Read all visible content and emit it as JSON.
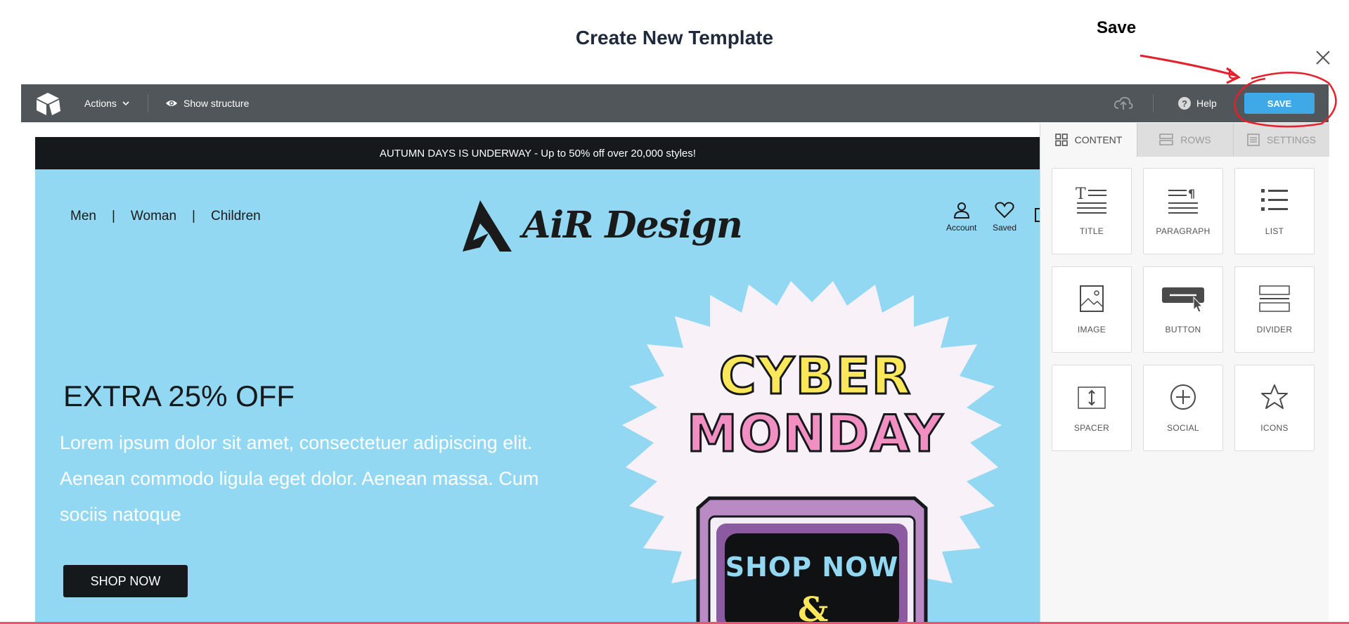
{
  "modal": {
    "title": "Create New Template",
    "close_icon": "close-icon"
  },
  "annotation": {
    "label": "Save",
    "color": "#e5202b"
  },
  "toolbar": {
    "actions_label": "Actions",
    "show_structure_label": "Show structure",
    "help_label": "Help",
    "save_label": "SAVE",
    "save_color": "#3fa9e8",
    "bg_color": "#505659"
  },
  "email": {
    "banner_text": "AUTUMN DAYS IS UNDERWAY - Up to 50% off over 20,000 styles!",
    "nav": {
      "men": "Men",
      "sep1": "|",
      "woman": "Woman",
      "sep2": "|",
      "children": "Children"
    },
    "brand_name": "AiR Design",
    "header_icons": {
      "account": "Account",
      "saved": "Saved"
    },
    "hero_title": "EXTRA 25% OFF",
    "hero_body": "Lorem ipsum dolor sit amet, consectetuer adipiscing elit. Aenean commodo ligula eget dolor. Aenean massa. Cum sociis natoque",
    "shop_button": "SHOP NOW",
    "promo": {
      "line1": "CYBER",
      "line2": "MONDAY",
      "cta": "SHOP NOW",
      "amp": "&"
    },
    "bg_color": "#93d8f3"
  },
  "panel": {
    "tabs": [
      {
        "label": "CONTENT",
        "icon": "grid-icon",
        "active": true
      },
      {
        "label": "ROWS",
        "icon": "rows-icon",
        "active": false
      },
      {
        "label": "SETTINGS",
        "icon": "settings-icon",
        "active": false
      }
    ],
    "tiles": [
      {
        "label": "TITLE",
        "icon": "title-icon"
      },
      {
        "label": "PARAGRAPH",
        "icon": "paragraph-icon"
      },
      {
        "label": "LIST",
        "icon": "list-icon"
      },
      {
        "label": "IMAGE",
        "icon": "image-icon"
      },
      {
        "label": "BUTTON",
        "icon": "button-icon"
      },
      {
        "label": "DIVIDER",
        "icon": "divider-icon"
      },
      {
        "label": "SPACER",
        "icon": "spacer-icon"
      },
      {
        "label": "SOCIAL",
        "icon": "social-icon"
      },
      {
        "label": "ICONS",
        "icon": "star-icon"
      }
    ]
  }
}
